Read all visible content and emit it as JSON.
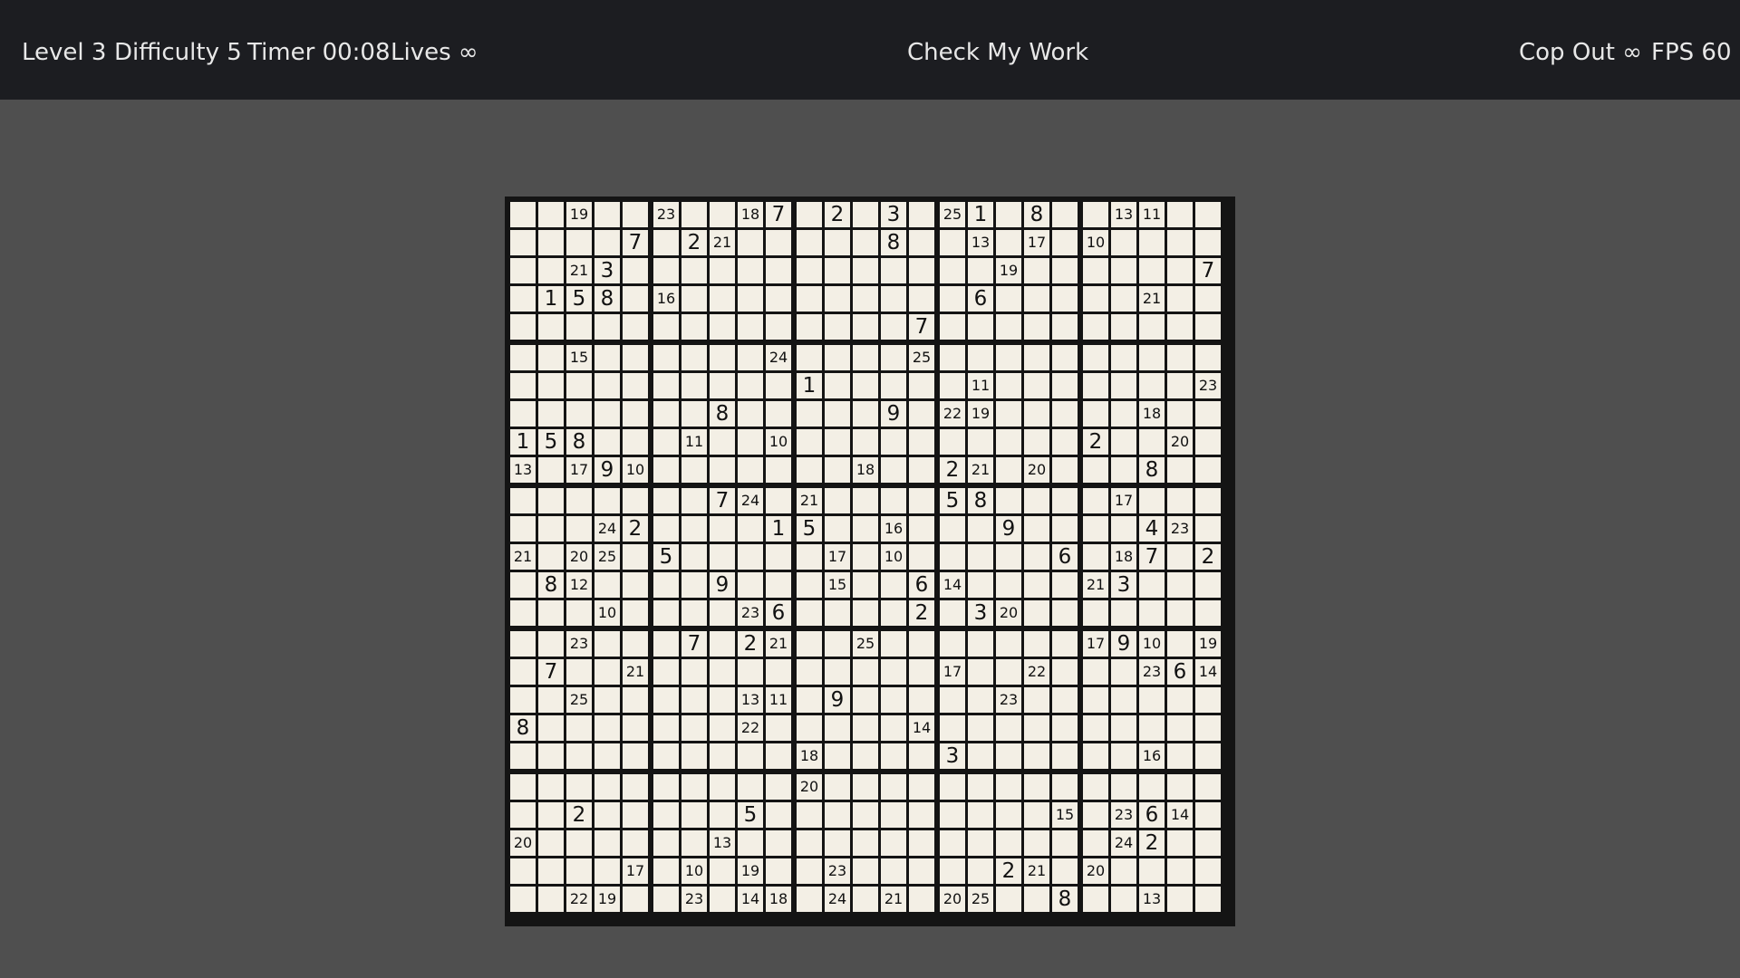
{
  "topbar": {
    "level": "Level 3",
    "difficulty": "Difficulty 5",
    "timer": "Timer 00:08",
    "lives": "Lives ∞",
    "check": "Check My Work",
    "copout": "Cop Out ∞",
    "fps": "FPS 60"
  },
  "colors": {
    "background": "#4f4f4f",
    "topbar": "#1c1d21",
    "topbar_text": "#e8e8e8",
    "cell": "#f3efe5",
    "grid_lines": "#141414",
    "digits": "#111111"
  },
  "board": {
    "size": 25,
    "box_size": 5,
    "rows": [
      [
        "",
        "",
        "19",
        "",
        "",
        "23",
        "",
        "",
        "18",
        "7",
        "",
        "2",
        "",
        "3",
        "",
        "25",
        "1",
        "",
        "8",
        "",
        "",
        "13",
        "11",
        "",
        ""
      ],
      [
        "",
        "",
        "",
        "",
        "7",
        "",
        "2",
        "21",
        "",
        "",
        "",
        "",
        "",
        "8",
        "",
        "",
        "13",
        "",
        "17",
        "",
        "10",
        "",
        "",
        "",
        ""
      ],
      [
        "",
        "",
        "21",
        "3",
        "",
        "",
        "",
        "",
        "",
        "",
        "",
        "",
        "",
        "",
        "",
        "",
        "",
        "19",
        "",
        "",
        "",
        "",
        "",
        "",
        "7"
      ],
      [
        "",
        "1",
        "5",
        "8",
        "",
        "16",
        "",
        "",
        "",
        "",
        "",
        "",
        "",
        "",
        "",
        "",
        "6",
        "",
        "",
        "",
        "",
        "",
        "21",
        "",
        ""
      ],
      [
        "",
        "",
        "",
        "",
        "",
        "",
        "",
        "",
        "",
        "",
        "",
        "",
        "",
        "",
        "7",
        "",
        "",
        "",
        "",
        "",
        "",
        "",
        "",
        "",
        ""
      ],
      [
        "",
        "",
        "15",
        "",
        "",
        "",
        "",
        "",
        "",
        "24",
        "",
        "",
        "",
        "",
        "25",
        "",
        "",
        "",
        "",
        "",
        "",
        "",
        "",
        "",
        ""
      ],
      [
        "",
        "",
        "",
        "",
        "",
        "",
        "",
        "",
        "",
        "",
        "1",
        "",
        "",
        "",
        "",
        "",
        "11",
        "",
        "",
        "",
        "",
        "",
        "",
        "",
        "23"
      ],
      [
        "",
        "",
        "",
        "",
        "",
        "",
        "",
        "8",
        "",
        "",
        "",
        "",
        "",
        "9",
        "",
        "22",
        "19",
        "",
        "",
        "",
        "",
        "",
        "18",
        "",
        ""
      ],
      [
        "1",
        "5",
        "8",
        "",
        "",
        "",
        "11",
        "",
        "",
        "10",
        "",
        "",
        "",
        "",
        "",
        "",
        "",
        "",
        "",
        "",
        "2",
        "",
        "",
        "20",
        ""
      ],
      [
        "13",
        "",
        "17",
        "9",
        "10",
        "",
        "",
        "",
        "",
        "",
        "",
        "",
        "18",
        "",
        "",
        "2",
        "21",
        "",
        "20",
        "",
        "",
        "",
        "8",
        "",
        ""
      ],
      [
        "",
        "",
        "",
        "",
        "",
        "",
        "",
        "7",
        "24",
        "",
        "21",
        "",
        "",
        "",
        "",
        "5",
        "8",
        "",
        "",
        "",
        "",
        "17",
        "",
        "",
        ""
      ],
      [
        "",
        "",
        "",
        "24",
        "2",
        "",
        "",
        "",
        "",
        "1",
        "5",
        "",
        "",
        "16",
        "",
        "",
        "",
        "9",
        "",
        "",
        "",
        "",
        "4",
        "23",
        ""
      ],
      [
        "21",
        "",
        "20",
        "25",
        "",
        "5",
        "",
        "",
        "",
        "",
        "",
        "17",
        "",
        "10",
        "",
        "",
        "",
        "",
        "",
        "6",
        "",
        "18",
        "7",
        "",
        "2"
      ],
      [
        "",
        "8",
        "12",
        "",
        "",
        "",
        "",
        "9",
        "",
        "",
        "",
        "15",
        "",
        "",
        "6",
        "14",
        "",
        "",
        "",
        "",
        "21",
        "3",
        "",
        "",
        ""
      ],
      [
        "",
        "",
        "",
        "10",
        "",
        "",
        "",
        "",
        "23",
        "6",
        "",
        "",
        "",
        "",
        "2",
        "",
        "3",
        "20",
        "",
        "",
        "",
        "",
        "",
        "",
        ""
      ],
      [
        "",
        "",
        "23",
        "",
        "",
        "",
        "7",
        "",
        "2",
        "21",
        "",
        "",
        "25",
        "",
        "",
        "",
        "",
        "",
        "",
        "",
        "17",
        "9",
        "10",
        "",
        "19"
      ],
      [
        "",
        "7",
        "",
        "",
        "21",
        "",
        "",
        "",
        "",
        "",
        "",
        "",
        "",
        "",
        "",
        "17",
        "",
        "",
        "22",
        "",
        "",
        "",
        "23",
        "6",
        "14"
      ],
      [
        "",
        "",
        "25",
        "",
        "",
        "",
        "",
        "",
        "13",
        "11",
        "",
        "9",
        "",
        "",
        "",
        "",
        "",
        "23",
        "",
        "",
        "",
        "",
        "",
        "",
        ""
      ],
      [
        "8",
        "",
        "",
        "",
        "",
        "",
        "",
        "",
        "22",
        "",
        "",
        "",
        "",
        "",
        "14",
        "",
        "",
        "",
        "",
        "",
        "",
        "",
        "",
        "",
        ""
      ],
      [
        "",
        "",
        "",
        "",
        "",
        "",
        "",
        "",
        "",
        "",
        "18",
        "",
        "",
        "",
        "",
        "3",
        "",
        "",
        "",
        "",
        "",
        "",
        "16",
        "",
        ""
      ],
      [
        "",
        "",
        "",
        "",
        "",
        "",
        "",
        "",
        "",
        "",
        "20",
        "",
        "",
        "",
        "",
        "",
        "",
        "",
        "",
        "",
        "",
        "",
        "",
        "",
        ""
      ],
      [
        "",
        "",
        "2",
        "",
        "",
        "",
        "",
        "",
        "5",
        "",
        "",
        "",
        "",
        "",
        "",
        "",
        "",
        "",
        "",
        "15",
        "",
        "23",
        "6",
        "14",
        ""
      ],
      [
        "20",
        "",
        "",
        "",
        "",
        "",
        "",
        "13",
        "",
        "",
        "",
        "",
        "",
        "",
        "",
        "",
        "",
        "",
        "",
        "",
        "",
        "24",
        "2",
        "",
        ""
      ],
      [
        "",
        "",
        "",
        "",
        "17",
        "",
        "10",
        "",
        "19",
        "",
        "",
        "23",
        "",
        "",
        "",
        "",
        "",
        "2",
        "21",
        "",
        "20",
        "",
        "",
        "",
        ""
      ],
      [
        "",
        "",
        "22",
        "19",
        "",
        "",
        "23",
        "",
        "14",
        "18",
        "",
        "24",
        "",
        "21",
        "",
        "20",
        "25",
        "",
        "",
        "8",
        "",
        "",
        "13",
        "",
        ""
      ]
    ]
  }
}
